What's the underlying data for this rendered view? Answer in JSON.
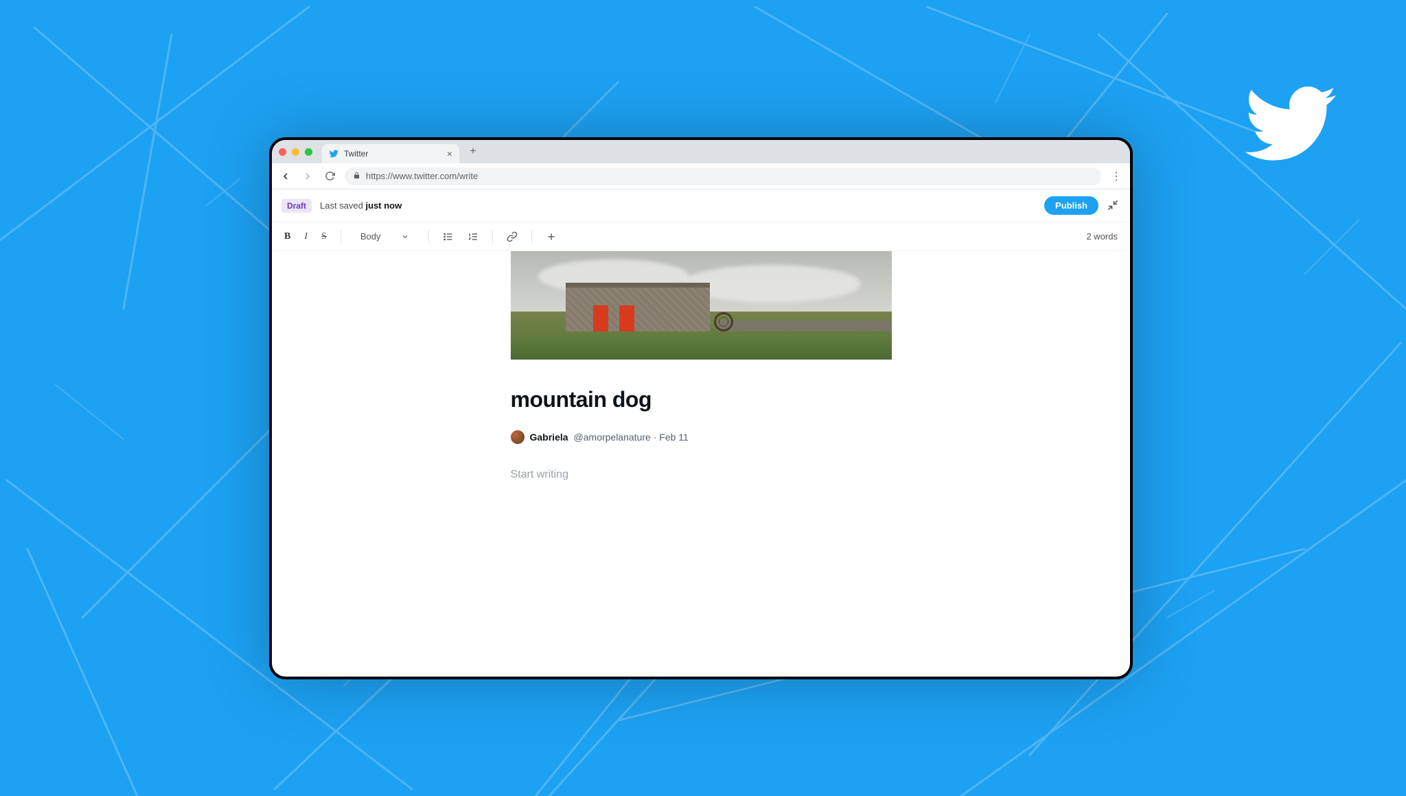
{
  "browser": {
    "tab_title": "Twitter",
    "url": "https://www.twitter.com/write"
  },
  "status_bar": {
    "draft_badge": "Draft",
    "last_saved_prefix": "Last saved ",
    "last_saved_value": "just now",
    "publish_label": "Publish"
  },
  "toolbar": {
    "text_style": "Body",
    "word_count": "2 words"
  },
  "document": {
    "title": "mountain dog",
    "author_name": "Gabriela",
    "author_handle": "@amorpelanature",
    "date": "Feb 11",
    "body_placeholder": "Start writing"
  }
}
